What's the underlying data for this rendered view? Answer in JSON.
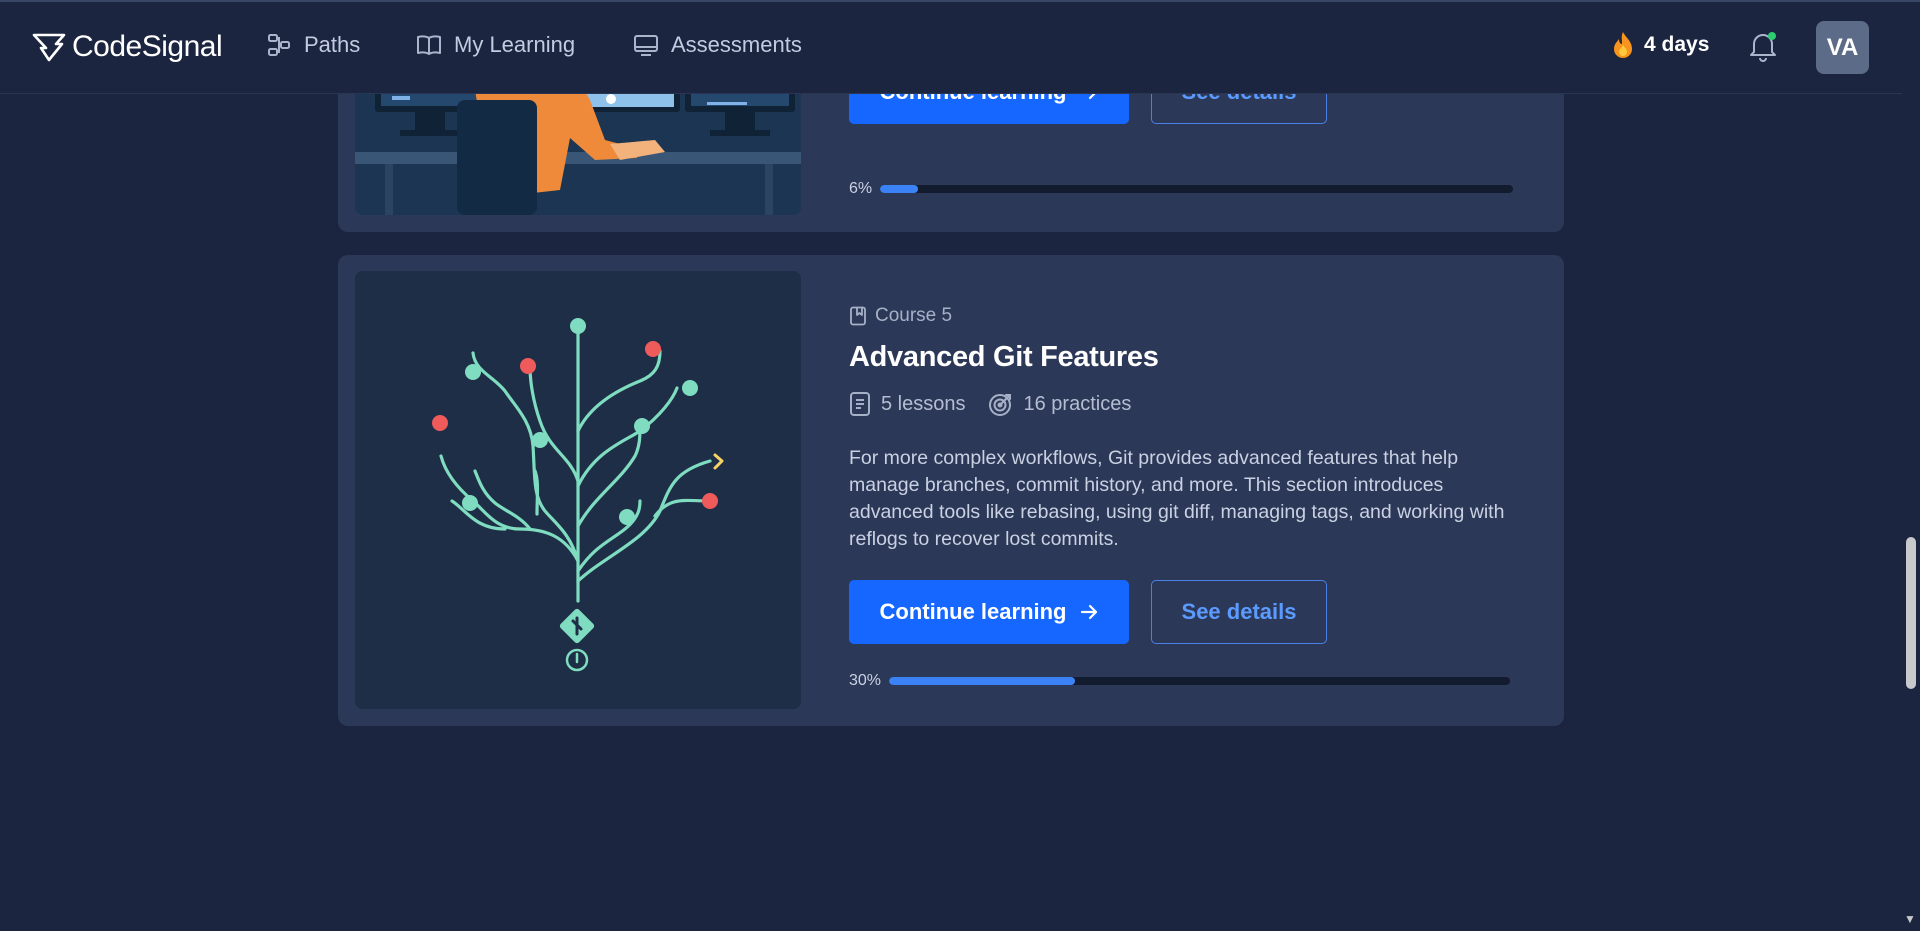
{
  "brand": {
    "name": "CodeSignal"
  },
  "nav": {
    "items": [
      {
        "label": "Paths",
        "icon": "paths-icon"
      },
      {
        "label": "My Learning",
        "icon": "book-open-icon"
      },
      {
        "label": "Assessments",
        "icon": "monitor-icon"
      }
    ],
    "streak": "4 days",
    "avatar_initials": "VA"
  },
  "cards": [
    {
      "continue_label": "Continue learning",
      "details_label": "See details",
      "progress_label": "6%",
      "progress": 0.06
    },
    {
      "course_label": "Course 5",
      "title": "Advanced Git Features",
      "lessons": "5 lessons",
      "practices": "16 practices",
      "description": "For more complex workflows, Git provides advanced features that help manage branches, commit history, and more. This section introduces advanced tools like rebasing, using git diff, managing tags, and working with reflogs to recover lost commits.",
      "continue_label": "Continue learning",
      "details_label": "See details",
      "progress_label": "30%",
      "progress": 0.3
    }
  ],
  "colors": {
    "background": "#1b2540",
    "card": "#2c3857",
    "primary": "#1667ff",
    "accent_green": "#7fdcc0",
    "accent_red": "#ef5a5a"
  }
}
